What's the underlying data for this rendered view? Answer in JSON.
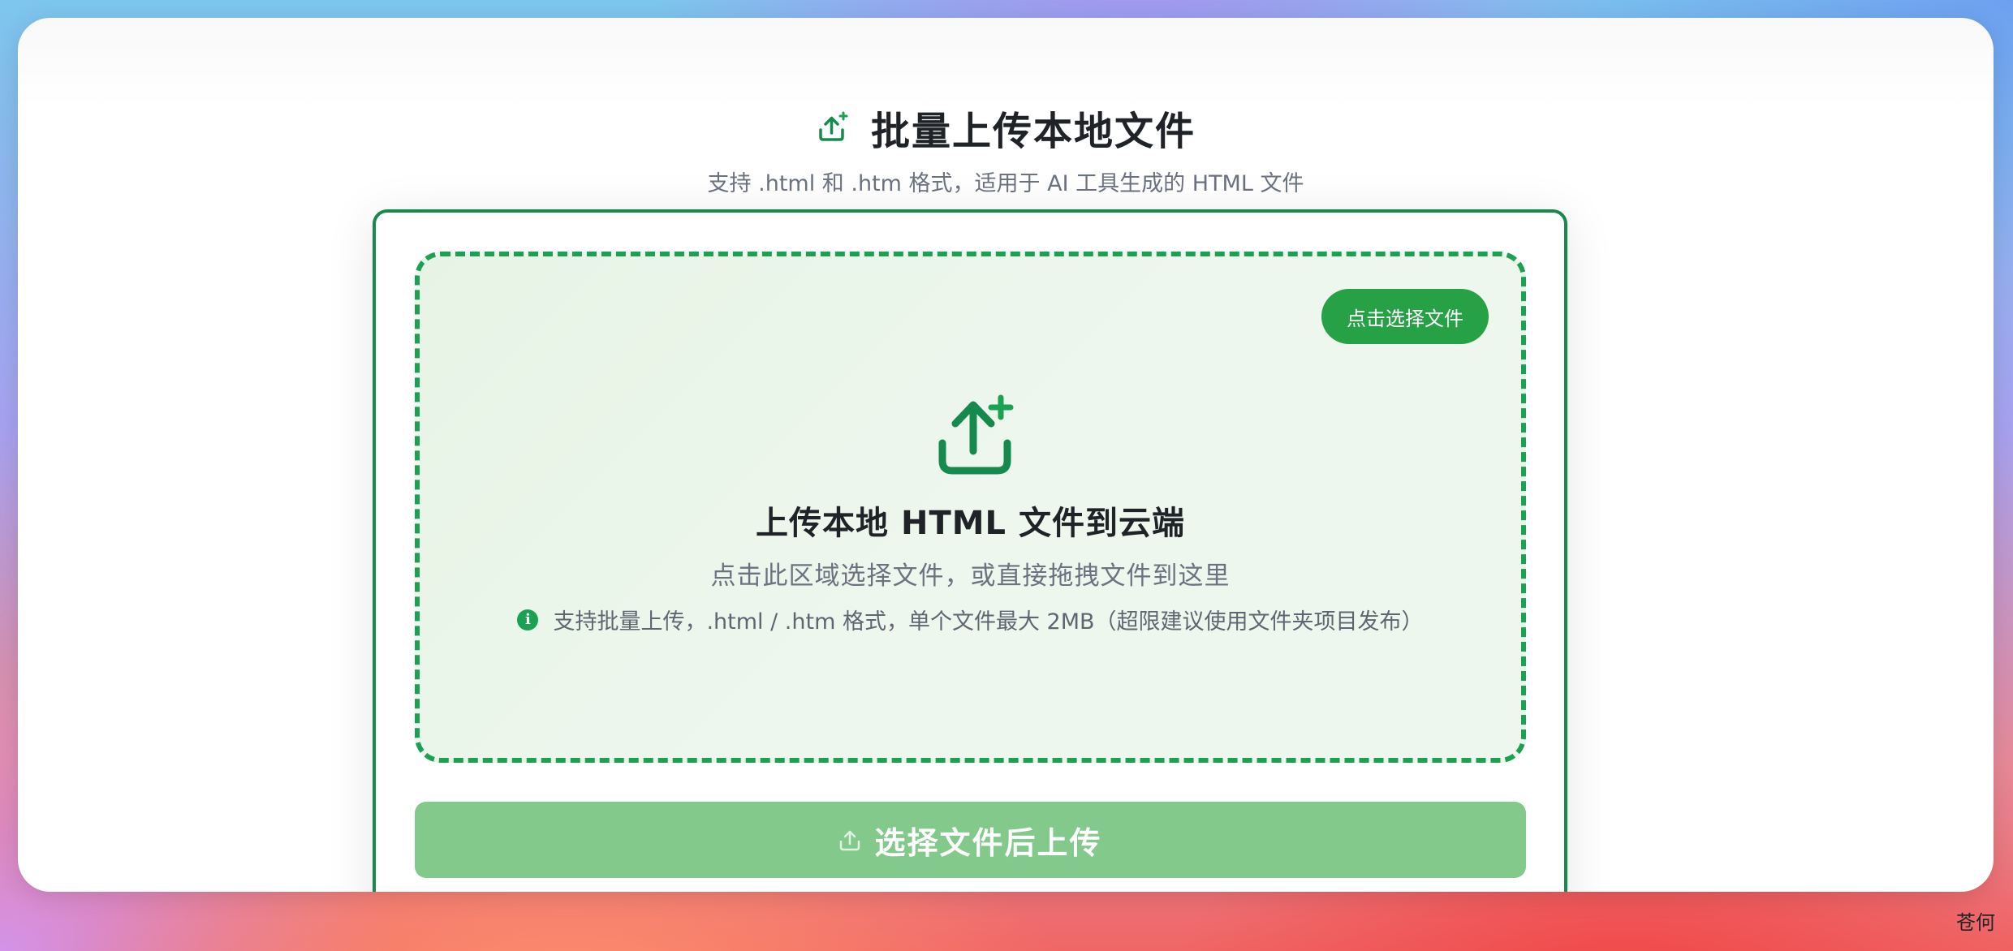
{
  "header": {
    "title": "批量上传本地文件",
    "subtitle": "支持 .html 和 .htm 格式，适用于 AI 工具生成的 HTML 文件",
    "icon": "upload-plus-icon"
  },
  "dropzone": {
    "select_button_label": "点击选择文件",
    "icon": "upload-plus-icon",
    "title": "上传本地 HTML 文件到云端",
    "hint": "点击此区域选择文件，或直接拖拽文件到这里",
    "note": "支持批量上传，.html / .htm 格式，单个文件最大 2MB（超限建议使用文件夹项目发布）",
    "note_icon": "info-icon",
    "info_glyph": "i"
  },
  "submit": {
    "label": "选择文件后上传",
    "enabled": false,
    "icon": "upload-icon"
  },
  "watermark": "苍何",
  "colors": {
    "accent": "#1aa151",
    "accent_dark": "#168a4c",
    "button": "#27a145",
    "button_disabled": "#82c98b",
    "dropzone_bg": "#eaf5e9"
  }
}
